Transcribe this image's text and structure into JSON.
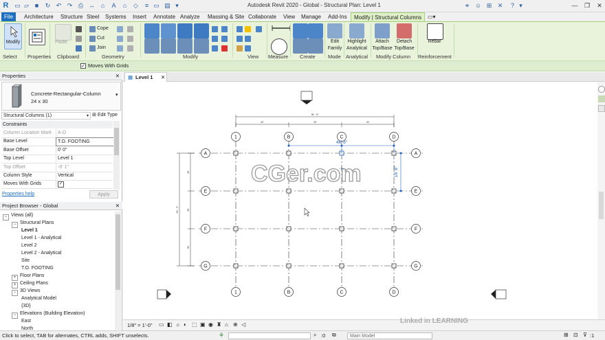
{
  "app": {
    "title": "Autodesk Revit 2020 - Global - Structural Plan: Level 1"
  },
  "ribbon": {
    "tabs": [
      "File",
      "Architecture",
      "Structure",
      "Steel",
      "Systems",
      "Insert",
      "Annotate",
      "Analyze",
      "Massing & Site",
      "Collaborate",
      "View",
      "Manage",
      "Add-Ins",
      "Modify | Structural Columns"
    ],
    "active_tab": "Modify | Structural Columns",
    "buttons": {
      "modify": "Modify",
      "paste": "Paste",
      "cope": "Cope",
      "cut": "Cut",
      "join": "Join",
      "edit_family": [
        "Edit",
        "Family"
      ],
      "highlight_analytical": [
        "Highlight",
        "Analytical"
      ],
      "attach": [
        "Attach",
        "Top/Base"
      ],
      "detach": [
        "Detach",
        "Top/Base"
      ],
      "rebar": "Rebar"
    },
    "panels": [
      "Select",
      "Properties",
      "Clipboard",
      "Geometry",
      "Modify",
      "View",
      "Measure",
      "Create",
      "Mode",
      "Analytical",
      "Modify Column",
      "Reinforcement"
    ]
  },
  "options_bar": {
    "moves_with_grids": "Moves With Grids",
    "checked": true
  },
  "properties": {
    "header": "Properties",
    "type_name": "Concrete-Rectangular-Column",
    "type_size": "24 x 30",
    "selector": "Structural Columns (1)",
    "edit_type": "Edit Type",
    "group": "Constraints",
    "rows": [
      {
        "key": "Column Location Mark",
        "value": "A-D",
        "dim": true
      },
      {
        "key": "Base Level",
        "value": "T.O. FOOTING",
        "dim": false
      },
      {
        "key": "Base Offset",
        "value": "0'  0\"",
        "dim": false
      },
      {
        "key": "Top Level",
        "value": "Level 1",
        "dim": false
      },
      {
        "key": "Top Offset",
        "value": "-0'  1\"",
        "dim": true
      },
      {
        "key": "Column Style",
        "value": "Vertical",
        "dim": false
      },
      {
        "key": "Moves With Grids",
        "value": "",
        "dim": false
      }
    ],
    "help": "Properties help",
    "apply": "Apply"
  },
  "project_browser": {
    "header": "Project Browser - Global",
    "items": [
      {
        "label": "Views (all)",
        "indent": 0,
        "toggle": "−",
        "bold": false
      },
      {
        "label": "Structural Plans",
        "indent": 1,
        "toggle": "−",
        "bold": false
      },
      {
        "label": "Level 1",
        "indent": 2,
        "toggle": "",
        "bold": true
      },
      {
        "label": "Level 1 - Analytical",
        "indent": 2,
        "toggle": "",
        "bold": false
      },
      {
        "label": "Level 2",
        "indent": 2,
        "toggle": "",
        "bold": false
      },
      {
        "label": "Level 2 - Analytical",
        "indent": 2,
        "toggle": "",
        "bold": false
      },
      {
        "label": "Site",
        "indent": 2,
        "toggle": "",
        "bold": false
      },
      {
        "label": "T.O. FOOTING",
        "indent": 2,
        "toggle": "",
        "bold": false
      },
      {
        "label": "Floor Plans",
        "indent": 1,
        "toggle": "+",
        "bold": false
      },
      {
        "label": "Ceiling Plans",
        "indent": 1,
        "toggle": "+",
        "bold": false
      },
      {
        "label": "3D Views",
        "indent": 1,
        "toggle": "−",
        "bold": false
      },
      {
        "label": "Analytical Model",
        "indent": 2,
        "toggle": "",
        "bold": false
      },
      {
        "label": "{3D}",
        "indent": 2,
        "toggle": "",
        "bold": false
      },
      {
        "label": "Elevations (Building Elevation)",
        "indent": 1,
        "toggle": "−",
        "bold": false
      },
      {
        "label": "East",
        "indent": 2,
        "toggle": "",
        "bold": false
      },
      {
        "label": "North",
        "indent": 2,
        "toggle": "",
        "bold": false
      }
    ]
  },
  "view": {
    "tab": "Level 1",
    "scale": "1/8\" = 1'-0\"",
    "grid_cols": [
      "1",
      "B",
      "C",
      "D"
    ],
    "grid_rows": [
      "A",
      "E",
      "F",
      "G"
    ],
    "temp_dim_h": "46' 8\"",
    "temp_dim_v": "16' 8\"",
    "top_dims": [
      "96' - 8\"",
      "32'",
      "32'",
      "32'"
    ],
    "side_dims": [
      "90' - 0\"",
      "30'",
      "30'",
      "30'"
    ]
  },
  "watermark": {
    "cger": "CGer.com",
    "linkedin": "Linked in LEARNING"
  },
  "status": {
    "hint": "Click to select, TAB for alternates, CTRL adds, SHIFT unselects.",
    "zero": ":0",
    "model": "Main Model",
    "filter_count": ":1"
  },
  "colors": {
    "file_tab": "#1e6fbf",
    "ribbon_bg": "#e9f3dc",
    "selection_blue": "#1f5fbf"
  }
}
